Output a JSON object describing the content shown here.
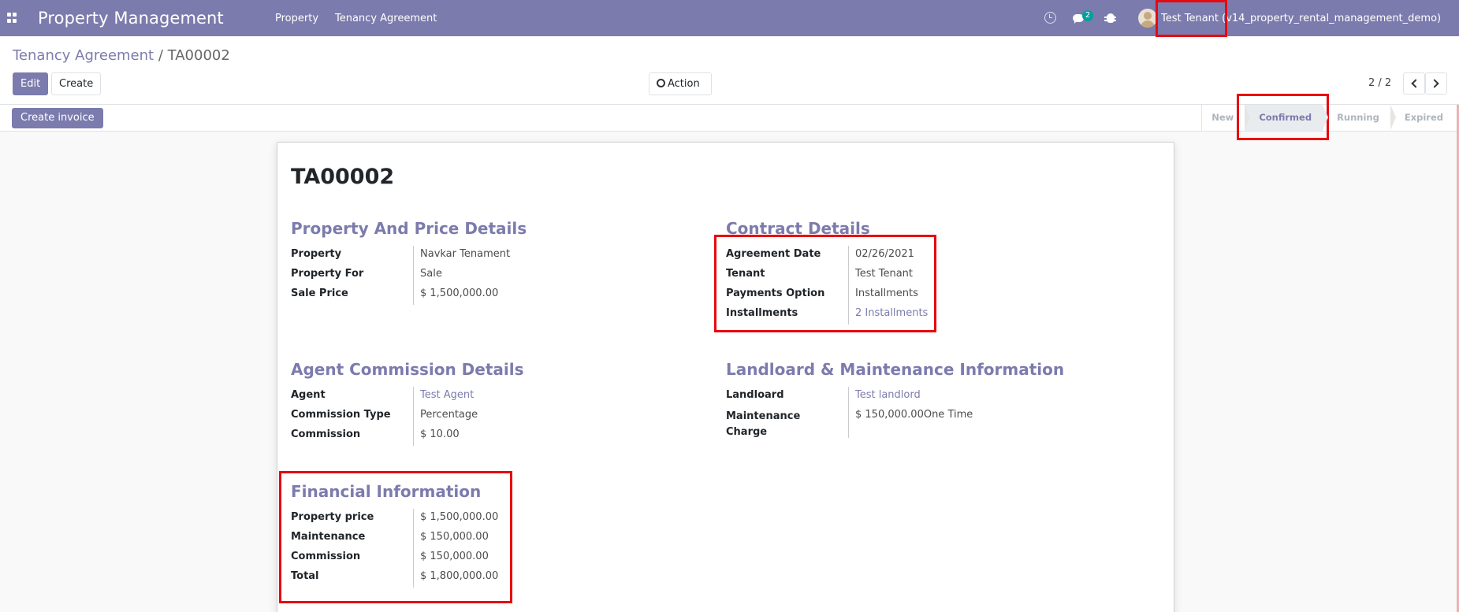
{
  "navbar": {
    "app_title": "Property Management",
    "menu": [
      "Property",
      "Tenancy Agreement"
    ],
    "messages_badge": "2",
    "user_label": "Test Tenant (v14_property_rental_management_demo)"
  },
  "breadcrumb": {
    "parent": "Tenancy Agreement",
    "separator": " / ",
    "current": "TA00002"
  },
  "toolbar": {
    "edit_label": "Edit",
    "create_label": "Create",
    "action_label": "Action",
    "pager": "2 / 2"
  },
  "statusbar": {
    "create_invoice_label": "Create invoice",
    "stages": [
      "New",
      "Confirmed",
      "Running",
      "Expired"
    ],
    "active_stage": "Confirmed"
  },
  "record": {
    "name": "TA00002",
    "property_price": {
      "title": "Property And Price Details",
      "fields": [
        {
          "label": "Property",
          "value": "Navkar Tenament"
        },
        {
          "label": "Property For",
          "value": "Sale"
        },
        {
          "label": "Sale Price",
          "value": "$ 1,500,000.00"
        }
      ]
    },
    "contract": {
      "title": "Contract Details",
      "fields": [
        {
          "label": "Agreement Date",
          "value": "02/26/2021"
        },
        {
          "label": "Tenant",
          "value": "Test Tenant"
        },
        {
          "label": "Payments Option",
          "value": "Installments"
        },
        {
          "label": "Installments",
          "value": "2 Installments"
        }
      ]
    },
    "agent": {
      "title": "Agent Commission Details",
      "fields": [
        {
          "label": "Agent",
          "value": "Test Agent"
        },
        {
          "label": "Commission Type",
          "value": "Percentage"
        },
        {
          "label": "Commission",
          "value": "$ 10.00"
        }
      ]
    },
    "landlord": {
      "title": "Landloard & Maintenance Information",
      "fields": [
        {
          "label": "Landloard",
          "value": "Test landlord"
        },
        {
          "label": "Maintenance Charge",
          "value": "$ 150,000.00One Time"
        }
      ]
    },
    "financial": {
      "title": "Financial Information",
      "fields": [
        {
          "label": "Property price",
          "value": "$ 1,500,000.00"
        },
        {
          "label": "Maintenance",
          "value": "$ 150,000.00"
        },
        {
          "label": "Commission",
          "value": "$ 150,000.00"
        },
        {
          "label": "Total",
          "value": "$ 1,800,000.00"
        }
      ]
    }
  },
  "colors": {
    "brand": "#7c7bad",
    "highlight": "#e8090e"
  }
}
